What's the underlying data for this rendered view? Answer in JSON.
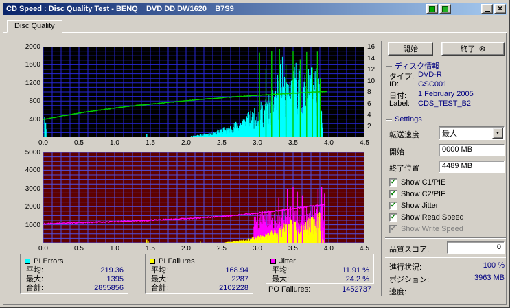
{
  "window": {
    "title": "CD Speed : Disc Quality Test - BENQ    DVD DD DW1620    B7S9"
  },
  "icons": {
    "close": "×",
    "dropdown": "▼",
    "exit_badge": "⊗"
  },
  "tabs": {
    "disc_quality": "Disc Quality"
  },
  "buttons": {
    "start": "開始",
    "exit": "終了"
  },
  "disc_info": {
    "header": "ディスク情報",
    "rows": [
      {
        "label": "タイプ:",
        "value": "DVD-R"
      },
      {
        "label": "ID:",
        "value": "GSC001"
      },
      {
        "label": "日付:",
        "value": "1 February 2005"
      },
      {
        "label": "Label:",
        "value": "CDS_TEST_B2"
      }
    ]
  },
  "settings": {
    "header": "Settings",
    "speed_label": "転送速度",
    "speed_value": "最大",
    "start_label": "開始",
    "start_value": "0000 MB",
    "end_label": "終了位置",
    "end_value": "4489 MB",
    "checkboxes": [
      {
        "label": "Show C1/PIE",
        "mark": "✓"
      },
      {
        "label": "Show C2/PIF",
        "mark": "✓"
      },
      {
        "label": "Show Jitter",
        "mark": "✓"
      },
      {
        "label": "Show Read Speed",
        "mark": "✓"
      },
      {
        "label": "Show Write Speed",
        "mark": "✓",
        "disabled": true
      }
    ],
    "quality_label": "品質スコア:",
    "quality_value": "0"
  },
  "status": {
    "rows": [
      {
        "label": "進行状況:",
        "value": "100 %"
      },
      {
        "label": "ポジション:",
        "value": "3963 MB"
      },
      {
        "label": "速度:",
        "value": ""
      }
    ]
  },
  "legend": {
    "pi_errors": {
      "title": "PI Errors",
      "color": "#00ffff",
      "rows": [
        [
          "平均:",
          "219.36"
        ],
        [
          "最大:",
          "1395"
        ],
        [
          "合計:",
          "2855856"
        ]
      ]
    },
    "pi_failures": {
      "title": "PI Failures",
      "color": "#ffff00",
      "rows": [
        [
          "平均:",
          "168.94"
        ],
        [
          "最大:",
          "2287"
        ],
        [
          "合計:",
          "2102228"
        ]
      ]
    },
    "jitter": {
      "title": "Jitter",
      "color": "#ff00ff",
      "rows": [
        [
          "平均:",
          "11.91 %"
        ],
        [
          "最大:",
          "24.2 %"
        ]
      ]
    },
    "po_failures": {
      "label": "PO Failures:",
      "value": "1452737"
    }
  },
  "chart_data": [
    {
      "type": "line",
      "xlim": [
        0,
        4.5
      ],
      "ylim": [
        0,
        2000
      ],
      "ylim_right": [
        0,
        16
      ],
      "bg": "#000000",
      "grid_color": "#2626d4",
      "grid_x": 0.125,
      "grid_y": 100,
      "x_ticks": [
        "0.0",
        "0.5",
        "1.0",
        "1.5",
        "2.0",
        "2.5",
        "3.0",
        "3.5",
        "4.0",
        "4.5"
      ],
      "y_left_ticks": [
        "2000",
        "1600",
        "1200",
        "800",
        "400"
      ],
      "y_right_ticks": [
        "16",
        "14",
        "12",
        "10",
        "8",
        "6",
        "4",
        "2"
      ],
      "series": [
        {
          "name": "pi-errors",
          "type": "spikes",
          "color": "#00ffff",
          "step": 0.005,
          "rand_min": 0.25,
          "rand_max": 1,
          "seed": 11,
          "points": [
            [
              2.05,
              25
            ],
            [
              2.2,
              70
            ],
            [
              2.35,
              120
            ],
            [
              2.5,
              210
            ],
            [
              2.65,
              310
            ],
            [
              2.8,
              470
            ],
            [
              2.95,
              630
            ],
            [
              3.1,
              860
            ],
            [
              3.2,
              1050
            ],
            [
              3.3,
              1450
            ],
            [
              3.34,
              1900
            ],
            [
              3.4,
              1250
            ],
            [
              3.5,
              1520
            ],
            [
              3.56,
              1900
            ],
            [
              3.62,
              1320
            ],
            [
              3.72,
              1520
            ],
            [
              3.8,
              1900
            ],
            [
              3.85,
              1450
            ],
            [
              3.89,
              1000
            ],
            [
              3.92,
              0
            ]
          ]
        },
        {
          "name": "pi-errors-extra",
          "type": "sticks",
          "color": "#00ffff",
          "points": [
            [
              0.02,
              450
            ],
            [
              0.035,
              320
            ],
            [
              0.05,
              180
            ],
            [
              1.45,
              70
            ]
          ]
        },
        {
          "name": "read-speed-spikes",
          "type": "sticks",
          "color": "#00cc00",
          "points": [
            [
              3.03,
              1870
            ],
            [
              3.12,
              1520
            ],
            [
              3.2,
              1900
            ],
            [
              3.31,
              1940
            ],
            [
              3.4,
              1620
            ],
            [
              3.5,
              1900
            ],
            [
              3.6,
              1720
            ],
            [
              3.69,
              1880
            ],
            [
              3.77,
              1540
            ],
            [
              3.84,
              1890
            ],
            [
              3.88,
              1300
            ]
          ]
        },
        {
          "name": "read-speed",
          "type": "line",
          "color": "#00cc00",
          "width": 1.5,
          "noise": 6,
          "seed": 3,
          "points": [
            [
              0,
              390
            ],
            [
              0.3,
              478
            ],
            [
              0.6,
              556
            ],
            [
              0.9,
              622
            ],
            [
              1.2,
              684
            ],
            [
              1.5,
              730
            ],
            [
              1.8,
              776
            ],
            [
              2.1,
              820
            ],
            [
              2.4,
              858
            ],
            [
              2.7,
              894
            ],
            [
              3.0,
              925
            ],
            [
              3.3,
              952
            ],
            [
              3.6,
              980
            ],
            [
              3.9,
              1006
            ],
            [
              3.98,
              1010
            ]
          ]
        }
      ]
    },
    {
      "type": "line",
      "xlim": [
        0,
        4.5
      ],
      "ylim": [
        0,
        5000
      ],
      "bg": "#5e0000",
      "grid_color": "#5050e0",
      "grid_x": 0.125,
      "grid_y": 250,
      "x_ticks": [
        "0.0",
        "0.5",
        "1.0",
        "1.5",
        "2.0",
        "2.5",
        "3.0",
        "3.5",
        "4.0",
        "4.5"
      ],
      "y_left_ticks": [
        "5000",
        "4000",
        "3000",
        "2000",
        "1000"
      ],
      "series": [
        {
          "name": "jitter-fuzz",
          "type": "spikes",
          "color": "#ff00ff",
          "step": 0.006,
          "rand_min": 0.35,
          "rand_max": 1,
          "seed": 5,
          "points": [
            [
              2.95,
              1750
            ],
            [
              3.1,
              1800
            ],
            [
              3.3,
              1900
            ],
            [
              3.5,
              2010
            ],
            [
              3.7,
              2080
            ],
            [
              3.85,
              2160
            ],
            [
              3.93,
              2120
            ],
            [
              3.95,
              0
            ]
          ]
        },
        {
          "name": "pi-failures",
          "type": "spikes",
          "color": "#ffff00",
          "step": 0.005,
          "rand_min": 0.3,
          "rand_max": 1,
          "seed": 23,
          "points": [
            [
              2.55,
              40
            ],
            [
              2.7,
              110
            ],
            [
              2.85,
              210
            ],
            [
              3.0,
              390
            ],
            [
              3.15,
              610
            ],
            [
              3.3,
              910
            ],
            [
              3.45,
              1260
            ],
            [
              3.55,
              1520
            ],
            [
              3.65,
              1260
            ],
            [
              3.75,
              1420
            ],
            [
              3.82,
              1560
            ],
            [
              3.86,
              2300
            ],
            [
              3.9,
              1100
            ],
            [
              3.93,
              0
            ]
          ]
        },
        {
          "name": "pi-failures-extra",
          "type": "sticks",
          "color": "#ffff00",
          "points": [
            [
              1.45,
              170
            ],
            [
              1.47,
              90
            ],
            [
              2.2,
              70
            ]
          ]
        },
        {
          "name": "jitter-peaks",
          "type": "sticks",
          "color": "#ff00ff",
          "points": [
            [
              3.3,
              2520
            ],
            [
              3.42,
              2960
            ],
            [
              3.5,
              3070
            ],
            [
              3.56,
              2820
            ],
            [
              3.63,
              2620
            ],
            [
              3.85,
              2960
            ],
            [
              3.9,
              3070
            ],
            [
              3.94,
              2720
            ]
          ]
        },
        {
          "name": "jitter",
          "type": "line",
          "color": "#ff00ff",
          "width": 1.4,
          "noise": 30,
          "seed": 9,
          "points": [
            [
              0,
              1050
            ],
            [
              0.3,
              1090
            ],
            [
              0.6,
              1128
            ],
            [
              0.9,
              1164
            ],
            [
              1.2,
              1204
            ],
            [
              1.5,
              1250
            ],
            [
              1.8,
              1304
            ],
            [
              2.1,
              1360
            ],
            [
              2.4,
              1432
            ],
            [
              2.7,
              1522
            ],
            [
              3.0,
              1640
            ],
            [
              3.3,
              1782
            ],
            [
              3.6,
              1950
            ],
            [
              3.8,
              2050
            ],
            [
              3.95,
              2110
            ]
          ]
        }
      ]
    }
  ]
}
